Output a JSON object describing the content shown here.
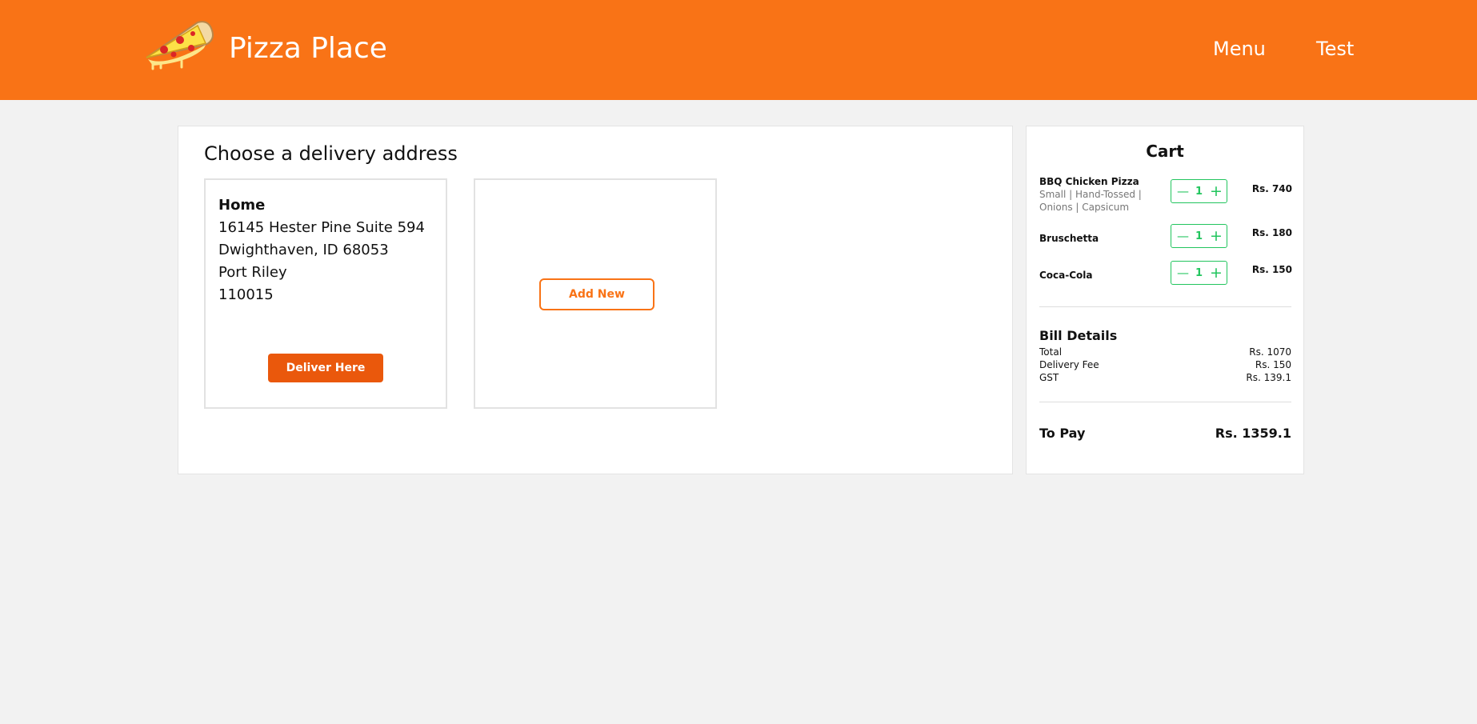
{
  "header": {
    "brand": "Pizza Place",
    "logo_icon": "pizza-slice-icon",
    "nav": [
      "Menu",
      "Test"
    ],
    "color": "#f97316"
  },
  "address": {
    "title": "Choose a delivery address",
    "home": {
      "name": "Home",
      "lines": [
        "16145 Hester Pine Suite 594",
        "Dwighthaven, ID 68053",
        "Port Riley",
        "110015"
      ],
      "button": "Deliver Here"
    },
    "add_new": "Add New"
  },
  "cart": {
    "title": "Cart",
    "items": [
      {
        "name": "BBQ Chicken Pizza",
        "desc": "Small | Hand-Tossed | Onions | Capsicum",
        "qty": "1",
        "price": "Rs. 740"
      },
      {
        "name": "Bruschetta",
        "desc": "",
        "qty": "1",
        "price": "Rs. 180"
      },
      {
        "name": "Coca-Cola",
        "desc": "",
        "qty": "1",
        "price": "Rs. 150"
      }
    ],
    "qty_minus": "—",
    "qty_plus": "+",
    "bill": {
      "title": "Bill Details",
      "rows": [
        {
          "label": "Total",
          "amount": "Rs. 1070"
        },
        {
          "label": "Delivery Fee",
          "amount": "Rs. 150"
        },
        {
          "label": "GST",
          "amount": "Rs. 139.1"
        }
      ],
      "to_pay_label": "To Pay",
      "to_pay_amount": "Rs. 1359.1"
    },
    "accent": "#22c55e"
  }
}
